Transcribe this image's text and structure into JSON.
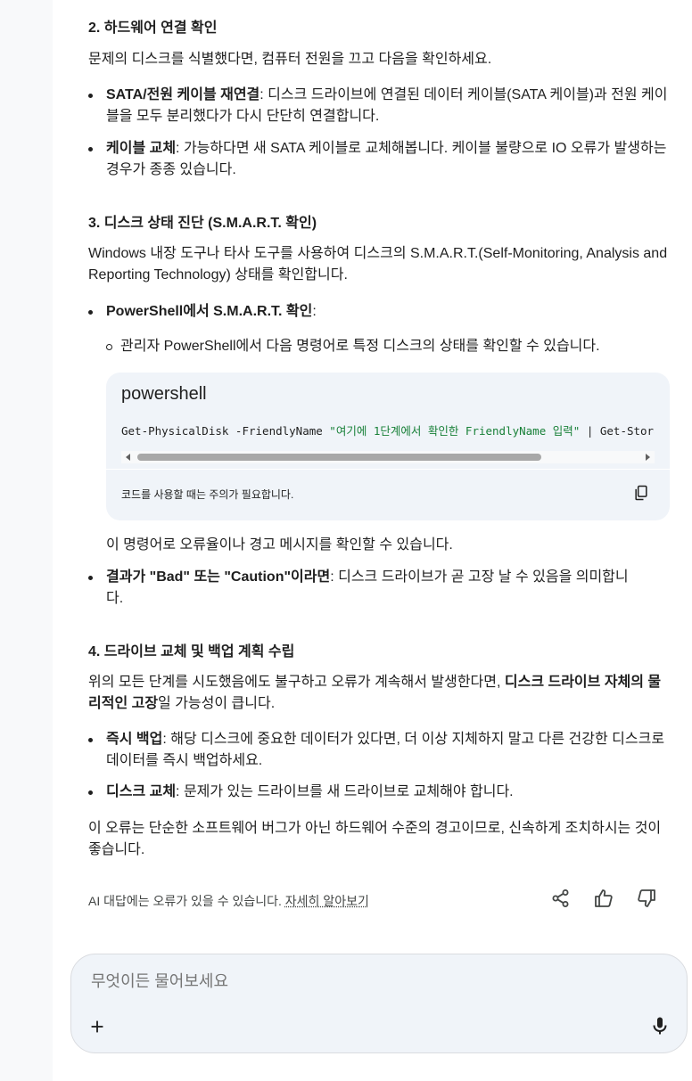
{
  "sections": {
    "s2": {
      "heading": "2. 하드웨어 연결 확인",
      "intro": "문제의 디스크를 식별했다면, 컴퓨터 전원을 끄고 다음을 확인하세요.",
      "items": [
        {
          "bold": "SATA/전원 케이블 재연결",
          "text": ": 디스크 드라이브에 연결된 데이터 케이블(SATA 케이블)과 전원 케이블을 모두 분리했다가 다시 단단히 연결합니다."
        },
        {
          "bold": "케이블 교체",
          "text": ": 가능하다면 새 SATA 케이블로 교체해봅니다. 케이블 불량으로 IO 오류가 발생하는 경우가 종종 있습니다."
        }
      ]
    },
    "s3": {
      "heading": "3. 디스크 상태 진단 (S.M.A.R.T. 확인)",
      "intro": "Windows 내장 도구나 타사 도구를 사용하여 디스크의 S.M.A.R.T.(Self-Monitoring, Analysis and Reporting Technology) 상태를 확인합니다.",
      "item1_bold": "PowerShell에서 S.M.A.R.T. 확인",
      "item1_text": ":",
      "sub_item": "관리자 PowerShell에서 다음 명령어로 특정 디스크의 상태를 확인할 수 있습니다.",
      "code": {
        "language": "powershell",
        "prefix": "Get-PhysicalDisk -FriendlyName ",
        "string": "\"여기에 1단계에서 확인한 FriendlyName 입력\"",
        "suffix": " | Get-StorageReliabilityCounter",
        "note": "코드를 사용할 때는 주의가 필요합니다."
      },
      "after_code": "이 명령어로 오류율이나 경고 메시지를 확인할 수 있습니다.",
      "item2_bold": "결과가 \"Bad\" 또는 \"Caution\"이라면",
      "item2_text": ": 디스크 드라이브가 곧 고장 날 수 있음을 의미합니다."
    },
    "s4": {
      "heading": "4. 드라이브 교체 및 백업 계획 수립",
      "intro_a": "위의 모든 단계를 시도했음에도 불구하고 오류가 계속해서 발생한다면, ",
      "intro_bold": "디스크 드라이브 자체의 물리적인 고장",
      "intro_b": "일 가능성이 큽니다.",
      "items": [
        {
          "bold": "즉시 백업",
          "text": ": 해당 디스크에 중요한 데이터가 있다면, 더 이상 지체하지 말고 다른 건강한 디스크로 데이터를 즉시 백업하세요."
        },
        {
          "bold": "디스크 교체",
          "text": ": 문제가 있는 드라이브를 새 드라이브로 교체해야 합니다."
        }
      ],
      "closing": "이 오류는 단순한 소프트웨어 버그가 아닌 하드웨어 수준의 경고이므로, 신속하게 조치하시는 것이 좋습니다."
    }
  },
  "feedback": {
    "disclaimer": "AI 대답에는 오류가 있을 수 있습니다. ",
    "learn_more": "자세히 알아보기",
    "icons": [
      "share-icon",
      "thumbs-up-icon",
      "thumbs-down-icon"
    ]
  },
  "composer": {
    "placeholder": "무엇이든 물어보세요",
    "icons": [
      "plus-icon",
      "mic-icon"
    ]
  },
  "colors": {
    "code_bg": "#f0f4f9",
    "code_string": "#188038",
    "left_rail": "#f8f9fa"
  }
}
